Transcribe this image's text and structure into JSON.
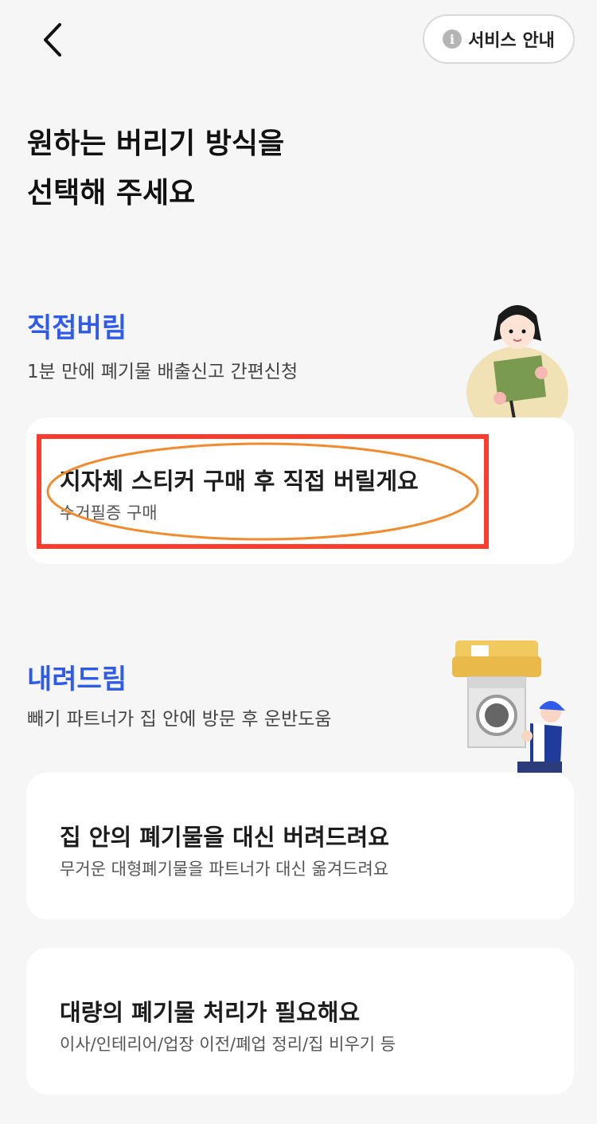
{
  "header": {
    "back_icon": "chevron-left-icon",
    "service_button": {
      "icon": "info-icon",
      "label": "서비스 안내"
    }
  },
  "title": {
    "line1": "원하는 버리기 방식을",
    "line2": "선택해 주세요"
  },
  "sections": [
    {
      "title": "직접버림",
      "desc": "1분 만에 폐기물 배출신고 간편신청",
      "illustration": "person-holding-sticker-illustration",
      "options": [
        {
          "title": "지자체 스티커 구매 후 직접 버릴게요",
          "sub": "수거필증 구매"
        }
      ]
    },
    {
      "title": "내려드림",
      "desc": "빼기 파트너가 집 안에 방문 후 운반도움",
      "illustration": "mover-carrying-washer-illustration",
      "options": [
        {
          "title": "집 안의 폐기물을 대신 버려드려요",
          "sub": "무거운 대형폐기물을 파트너가 대신 옮겨드려요"
        },
        {
          "title": "대량의 폐기물 처리가 필요해요",
          "sub": "이사/인테리어/업장 이전/폐업 정리/집 비우기 등"
        }
      ]
    }
  ],
  "colors": {
    "accent": "#2f5bea",
    "highlight_box": "#ff3b2e",
    "highlight_oval": "#f28a2e",
    "background": "#f6f6f6",
    "card": "#ffffff"
  }
}
